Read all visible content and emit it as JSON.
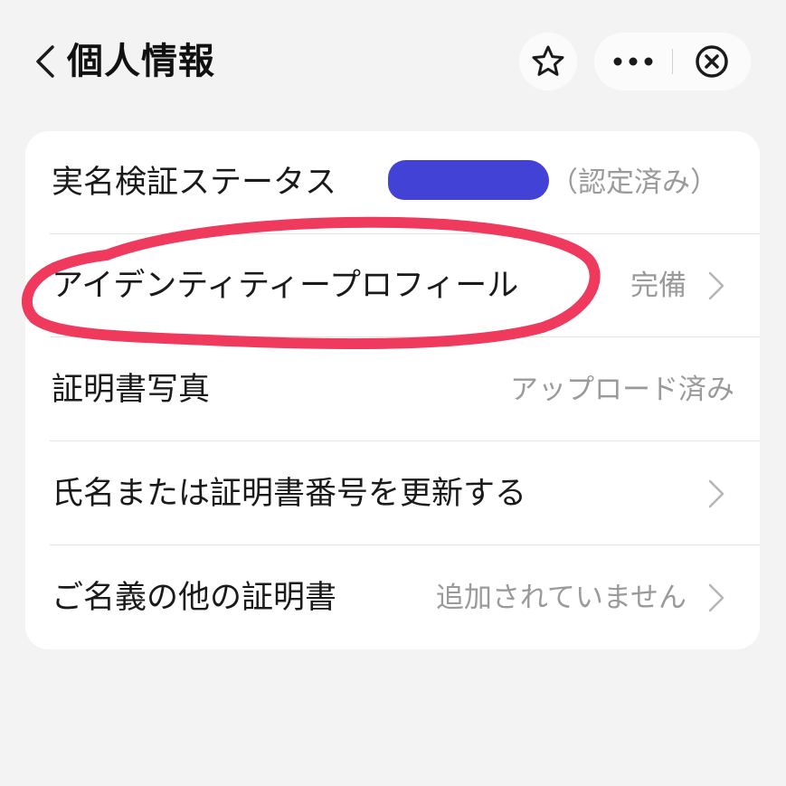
{
  "header": {
    "back_icon": "chevron-left-icon",
    "title": "個人情報",
    "star_icon": "star-outline-icon",
    "more_icon": "more-horizontal-icon",
    "close_icon": "close-circle-icon"
  },
  "rows": [
    {
      "label": "実名検証ステータス",
      "value": "（認定済み）",
      "redacted": true,
      "has_chevron": false
    },
    {
      "label": "アイデンティティープロフィール",
      "value": "完備",
      "has_chevron": true,
      "highlighted": true
    },
    {
      "label": "証明書写真",
      "value": "アップロード済み",
      "has_chevron": false
    },
    {
      "label": "氏名または証明書番号を更新する",
      "value": "",
      "has_chevron": true
    },
    {
      "label": "ご名義の他の証明書",
      "value": "追加されていません",
      "has_chevron": true
    }
  ],
  "colors": {
    "background": "#f3f3f3",
    "card": "#ffffff",
    "redaction": "#4243d6",
    "highlight": "#ef3a5d",
    "secondary_text": "#9a9a9a"
  }
}
